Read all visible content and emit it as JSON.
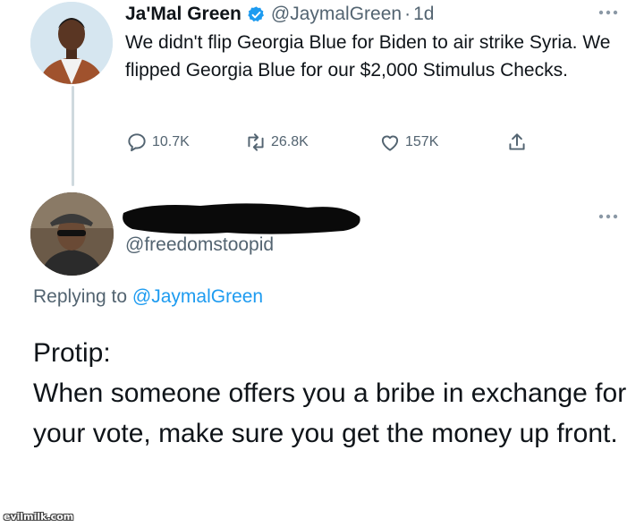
{
  "tweet": {
    "author_name": "Ja'Mal Green",
    "handle": "@JaymalGreen",
    "separator": "·",
    "time": "1d",
    "body": "We didn't flip Georgia Blue for Biden to air strike Syria. We flipped Georgia Blue for our $2,000 Stimulus Checks.",
    "replies": "10.7K",
    "retweets": "26.8K",
    "likes": "157K",
    "verified_color": "#1d9bf0"
  },
  "reply": {
    "handle": "@freedomstoopid",
    "replying_prefix": "Replying to",
    "replying_to": "@JaymalGreen",
    "body_line_1": "Protip:",
    "body_line_2": "When someone offers you a bribe in exchange for your vote, make sure you get the money up front."
  },
  "watermark": "evilmilk.com",
  "colors": {
    "text": "#0f1419",
    "secondary": "#536471",
    "link": "#1d9bf0",
    "thread_line": "#cfd9de"
  },
  "icons": [
    "verified-badge-icon",
    "more-options-icon",
    "reply-icon",
    "retweet-icon",
    "like-icon",
    "share-icon"
  ]
}
